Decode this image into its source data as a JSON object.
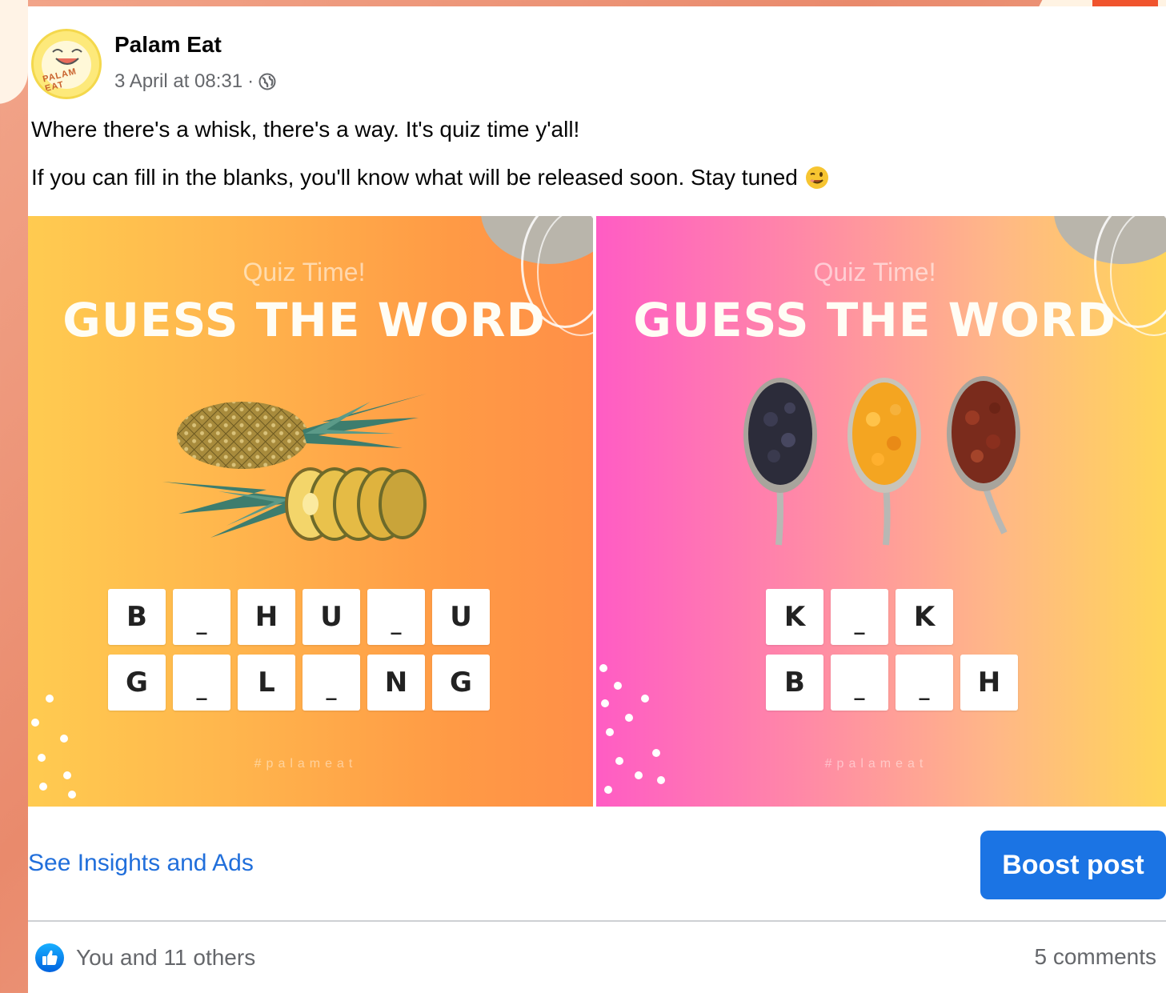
{
  "post": {
    "page_name": "Palam Eat",
    "avatar_text": "PALAM EAT",
    "timestamp": "3 April at 08:31",
    "separator": "·",
    "audience_icon": "globe-icon",
    "text_line_1": "Where there's a whisk, there's a way. It's quiz time y'all!",
    "text_line_2": "If you can fill in the blanks, you'll know what will be released soon. Stay tuned",
    "emoji": "winking-face"
  },
  "images": [
    {
      "subtitle": "Quiz Time!",
      "title": "GUESS THE WORD",
      "picture": "pineapple",
      "rows": [
        [
          "B",
          "_",
          "H",
          "U",
          "_",
          "U"
        ],
        [
          "G",
          "_",
          "L",
          "_",
          "N",
          "G"
        ]
      ],
      "handle": "#palameat"
    },
    {
      "subtitle": "Quiz Time!",
      "title": "GUESS THE WORD",
      "picture": "raisins-on-spoons",
      "rows": [
        [
          "K",
          "_",
          "K"
        ],
        [
          "B",
          "_",
          "_",
          "H"
        ]
      ],
      "handle": "#palameat"
    }
  ],
  "actions": {
    "insights_label": "See Insights and Ads",
    "boost_label": "Boost post"
  },
  "engagement": {
    "reactions_text": "You and 11 others",
    "reaction_icon": "like-icon",
    "comments_text": "5 comments"
  },
  "colors": {
    "link_blue": "#216fdb",
    "boost_blue": "#1b74e4",
    "background_salmon": "#ec9175"
  }
}
